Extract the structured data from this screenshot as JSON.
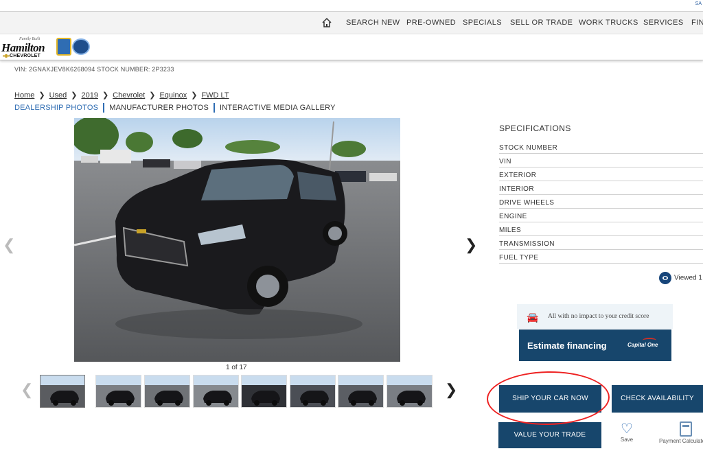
{
  "top_strip": {
    "tiny_text": "SA"
  },
  "nav": {
    "items": [
      "SEARCH NEW",
      "PRE-OWNED",
      "SPECIALS",
      "SELL OR TRADE",
      "WORK TRUCKS",
      "SERVICES",
      "FIN"
    ]
  },
  "dealer": {
    "logo_text": "Hamilton",
    "logo_sub": "CHEVROLET",
    "logo_script": "Family Built"
  },
  "vehicle": {
    "vin_line": "VIN: 2GNAXJEV8K6268094   STOCK NUMBER: 2P3233"
  },
  "breadcrumb": [
    "Home",
    "Used",
    "2019",
    "Chevrolet",
    "Equinox",
    "FWD LT"
  ],
  "photo_tabs": [
    "DEALERSHIP PHOTOS",
    "MANUFACTURER PHOTOS",
    "INTERACTIVE MEDIA GALLERY"
  ],
  "gallery": {
    "counter": "1 of 17",
    "thumb_count": 8
  },
  "specs": {
    "title": "SPECIFICATIONS",
    "rows": [
      "STOCK NUMBER",
      "VIN",
      "EXTERIOR",
      "INTERIOR",
      "DRIVE WHEELS",
      "ENGINE",
      "MILES",
      "TRANSMISSION",
      "FUEL TYPE"
    ]
  },
  "viewed": {
    "text": "Viewed 1"
  },
  "financing": {
    "credit_note": "All with no impact to your credit score",
    "estimate_label": "Estimate financing",
    "partner": "Capital One"
  },
  "actions": {
    "ship": "SHIP YOUR CAR NOW",
    "check": "CHECK AVAILABILITY",
    "trade": "VALUE YOUR TRADE",
    "save": "Save",
    "payment": "Payment Calculator"
  }
}
